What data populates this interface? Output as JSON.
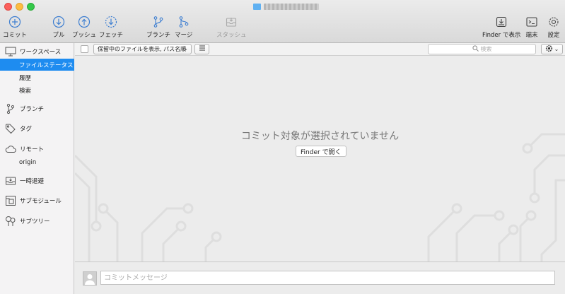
{
  "window": {
    "title_blurred": true
  },
  "toolbar": {
    "commit": "コミット",
    "pull": "プル",
    "push": "プッシュ",
    "fetch": "フェッチ",
    "branch": "ブランチ",
    "merge": "マージ",
    "stash": "スタッシュ",
    "finder": "Finder で表示",
    "terminal": "端末",
    "settings": "設定"
  },
  "sidebar": {
    "workspace": "ワークスペース",
    "file_status": "ファイルステータス",
    "history": "履歴",
    "search": "検索",
    "branches": "ブランチ",
    "tags": "タグ",
    "remotes": "リモート",
    "origin": "origin",
    "stashes": "一時退避",
    "submodules": "サブモジュール",
    "subtrees": "サブツリー"
  },
  "filterbar": {
    "dropdown_label": "保留中のファイルを表示, パス名順",
    "search_placeholder": "検索"
  },
  "main": {
    "empty_message": "コミット対象が選択されていません",
    "open_in_finder": "Finder で開く"
  },
  "commit": {
    "placeholder": "コミットメッセージ"
  },
  "colors": {
    "accent": "#1e8cf0",
    "toolbar_icon": "#3d7ed1"
  }
}
